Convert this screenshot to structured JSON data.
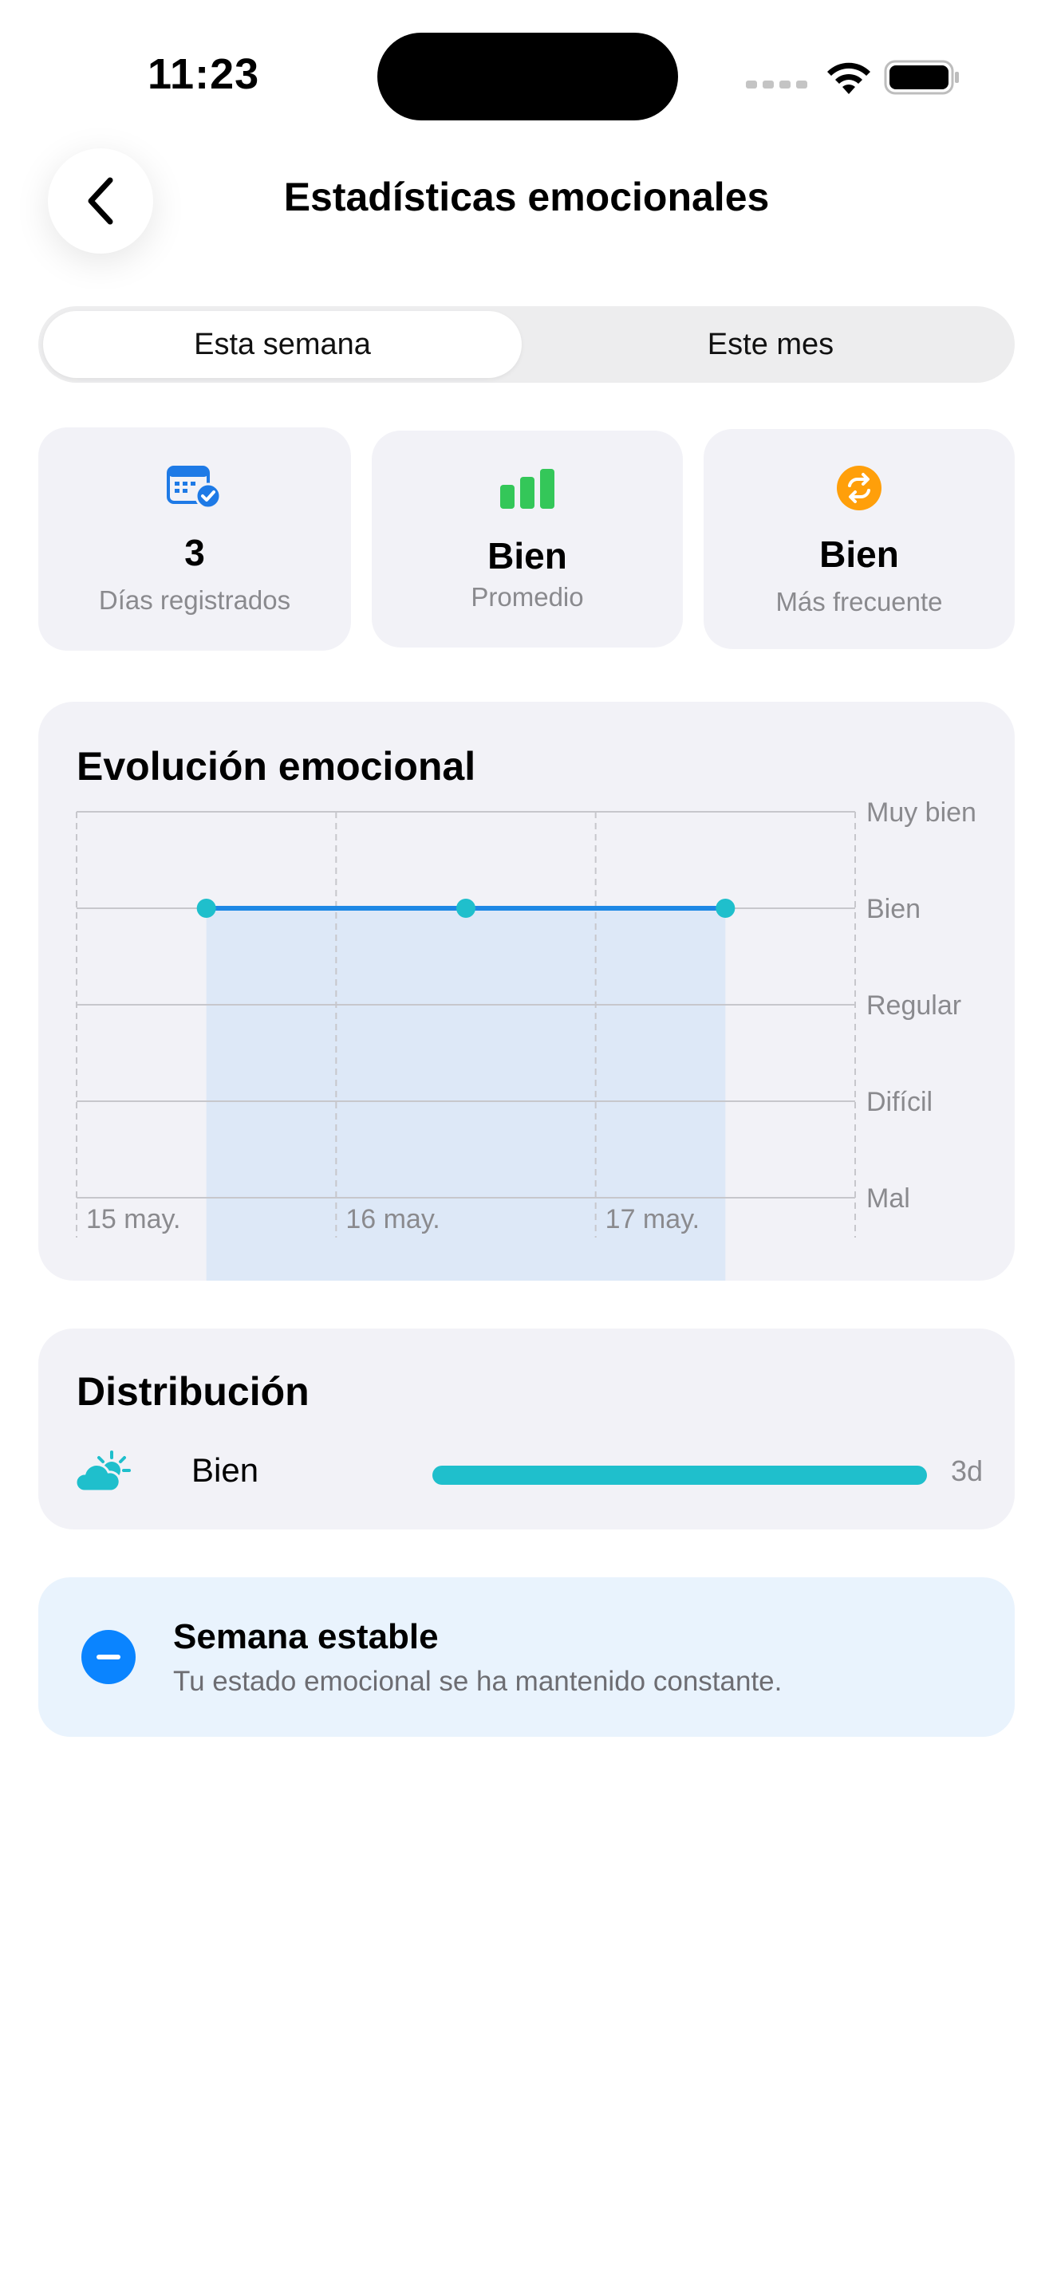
{
  "status_bar": {
    "time": "11:23"
  },
  "header": {
    "title": "Estadísticas emocionales"
  },
  "segmented": {
    "options": [
      "Esta semana",
      "Este mes"
    ],
    "selected": "Esta semana"
  },
  "stats": [
    {
      "icon": "calendar-check-icon",
      "value": "3",
      "label": "Días registrados",
      "color": "#1e7ae6"
    },
    {
      "icon": "bar-chart-icon",
      "value": "Bien",
      "label": "Promedio",
      "color": "#34c759"
    },
    {
      "icon": "repeat-icon",
      "value": "Bien",
      "label": "Más frecuente",
      "color": "#ff9f0a"
    }
  ],
  "evolution": {
    "title": "Evolución emocional",
    "chart_data": {
      "type": "line",
      "x": [
        "15 may.",
        "16 may.",
        "17 may."
      ],
      "series": [
        {
          "values": [
            "Bien",
            "Bien",
            "Bien"
          ]
        }
      ],
      "y_categories": [
        "Mal",
        "Difícil",
        "Regular",
        "Bien",
        "Muy bien"
      ],
      "grid": true,
      "colors": {
        "line": "#1e88e5",
        "points": "#1fbfcc",
        "area": "#dde8f7"
      }
    }
  },
  "distribution": {
    "title": "Distribución",
    "items": [
      {
        "icon": "partly-sunny-icon",
        "label": "Bien",
        "count": "3d",
        "fraction": 1.0,
        "color": "#1fbfcc"
      }
    ]
  },
  "insight": {
    "title": "Semana estable",
    "text": "Tu estado emocional se ha mantenido constante."
  }
}
